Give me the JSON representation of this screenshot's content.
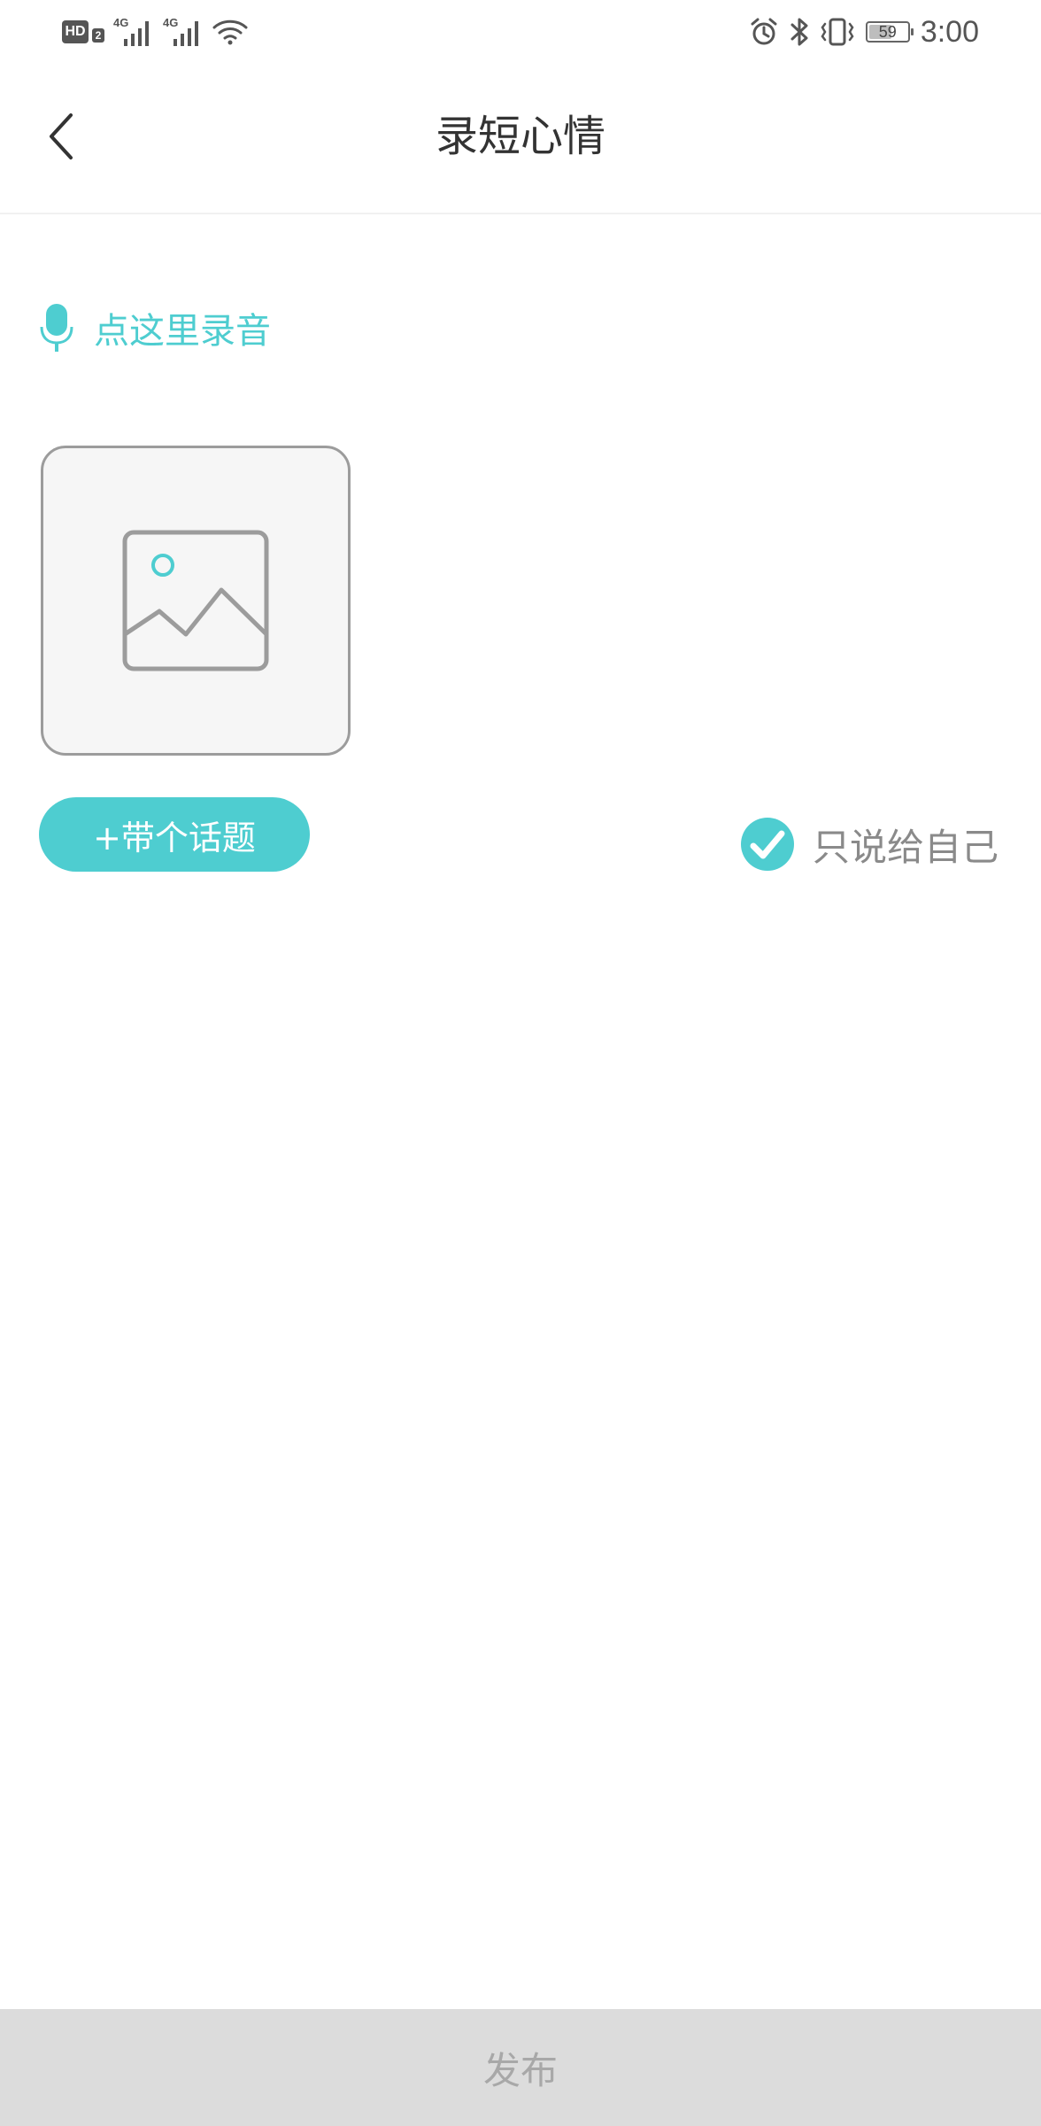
{
  "status_bar": {
    "hd_label": "HD",
    "hd_sub": "2",
    "network1": "4G",
    "network2": "4G",
    "battery_level": 59,
    "battery_text": "59",
    "time": "3:00"
  },
  "header": {
    "title": "录短心情",
    "back_icon": "chevron-left-icon"
  },
  "record": {
    "label": "点这里录音",
    "icon": "microphone-icon"
  },
  "image_picker": {
    "icon": "image-placeholder-icon"
  },
  "topic": {
    "label": "+带个话题"
  },
  "privacy": {
    "label": "只说给自己",
    "checked": true,
    "icon": "check-circle-icon"
  },
  "footer": {
    "publish_label": "发布"
  },
  "colors": {
    "accent": "#4ecdd0",
    "footer_bg": "#dcdcdc",
    "footer_text": "#a8a8a8",
    "title_text": "#333333",
    "muted_text": "#8a8a8a"
  }
}
